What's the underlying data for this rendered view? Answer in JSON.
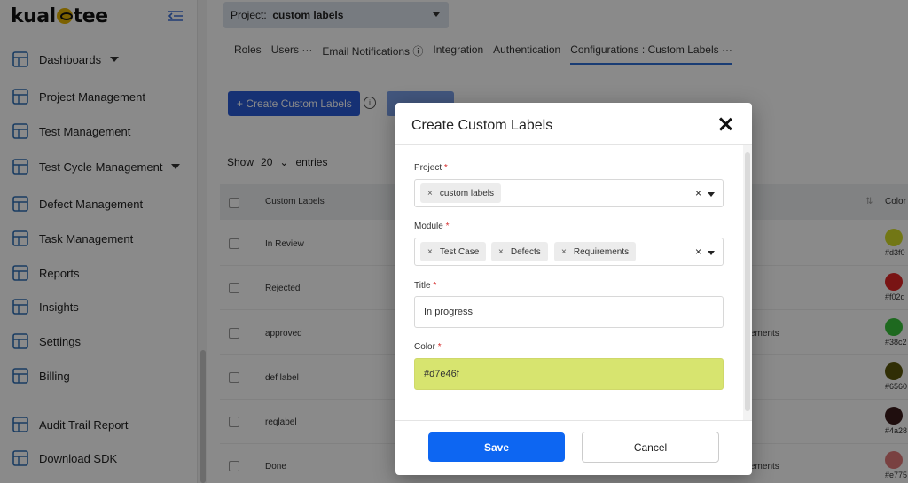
{
  "app": {
    "logo_text_a": "kual",
    "logo_text_b": "tee"
  },
  "sidebar": {
    "items": [
      {
        "label": "Dashboards",
        "icon": "layout-icon",
        "has_caret": true
      },
      {
        "label": "Project Management",
        "icon": "org-chart-icon"
      },
      {
        "label": "Test Management",
        "icon": "test-monitor-icon"
      },
      {
        "label": "Test Cycle Management",
        "icon": "flask-icon",
        "has_caret": true
      },
      {
        "label": "Defect Management",
        "icon": "bug-icon"
      },
      {
        "label": "Task Management",
        "icon": "clipboard-icon"
      },
      {
        "label": "Reports",
        "icon": "report-icon"
      },
      {
        "label": "Insights",
        "icon": "magnifier-chart-icon"
      },
      {
        "label": "Settings",
        "icon": "gear-icon"
      },
      {
        "label": "Billing",
        "icon": "billing-icon"
      },
      {
        "label": "Audit Trail Report",
        "icon": "audit-icon"
      },
      {
        "label": "Download SDK",
        "icon": "layers-icon"
      }
    ]
  },
  "header": {
    "project_label": "Project:",
    "project_value": "custom labels"
  },
  "tabs": [
    {
      "label": "Roles"
    },
    {
      "label": "Users ···"
    },
    {
      "label": "Email Notifications ⓘ"
    },
    {
      "label": "Integration"
    },
    {
      "label": "Authentication"
    },
    {
      "label": "Configurations : Custom Labels ···",
      "active": true
    }
  ],
  "toolbar": {
    "create_label": "+  Create Custom Labels"
  },
  "entries": {
    "show": "Show",
    "count": "20",
    "suffix": "entries"
  },
  "table": {
    "headers": {
      "name": "Custom Labels",
      "color": "Color"
    },
    "rows": [
      {
        "name": "In Review",
        "module": "",
        "color": "#d3dc28",
        "hex": "#d3f0"
      },
      {
        "name": "Rejected",
        "module": "",
        "color": "#e02626",
        "hex": "#f02d"
      },
      {
        "name": "approved",
        "module": "ements",
        "color": "#38c23a",
        "hex": "#38c2"
      },
      {
        "name": "def label",
        "module": "",
        "color": "#5a560a",
        "hex": "#6560"
      },
      {
        "name": "reqlabel",
        "module": "",
        "color": "#3a1a1a",
        "hex": "#4a28"
      },
      {
        "name": "Done",
        "module": "ements",
        "color": "#e07878",
        "hex": "#e775"
      }
    ]
  },
  "modal": {
    "title": "Create Custom Labels",
    "project": {
      "label": "Project",
      "required": "*",
      "chips": [
        "custom labels"
      ]
    },
    "module": {
      "label": "Module",
      "required": "*",
      "chips": [
        "Test Case",
        "Defects",
        "Requirements"
      ]
    },
    "title_field": {
      "label": "Title",
      "required": "*",
      "value": "In progress"
    },
    "color_field": {
      "label": "Color",
      "required": "*",
      "value": "#d7e46f",
      "bg": "#d7e46f"
    },
    "save_label": "Save",
    "cancel_label": "Cancel",
    "chip_remove": "×",
    "clear": "×"
  }
}
